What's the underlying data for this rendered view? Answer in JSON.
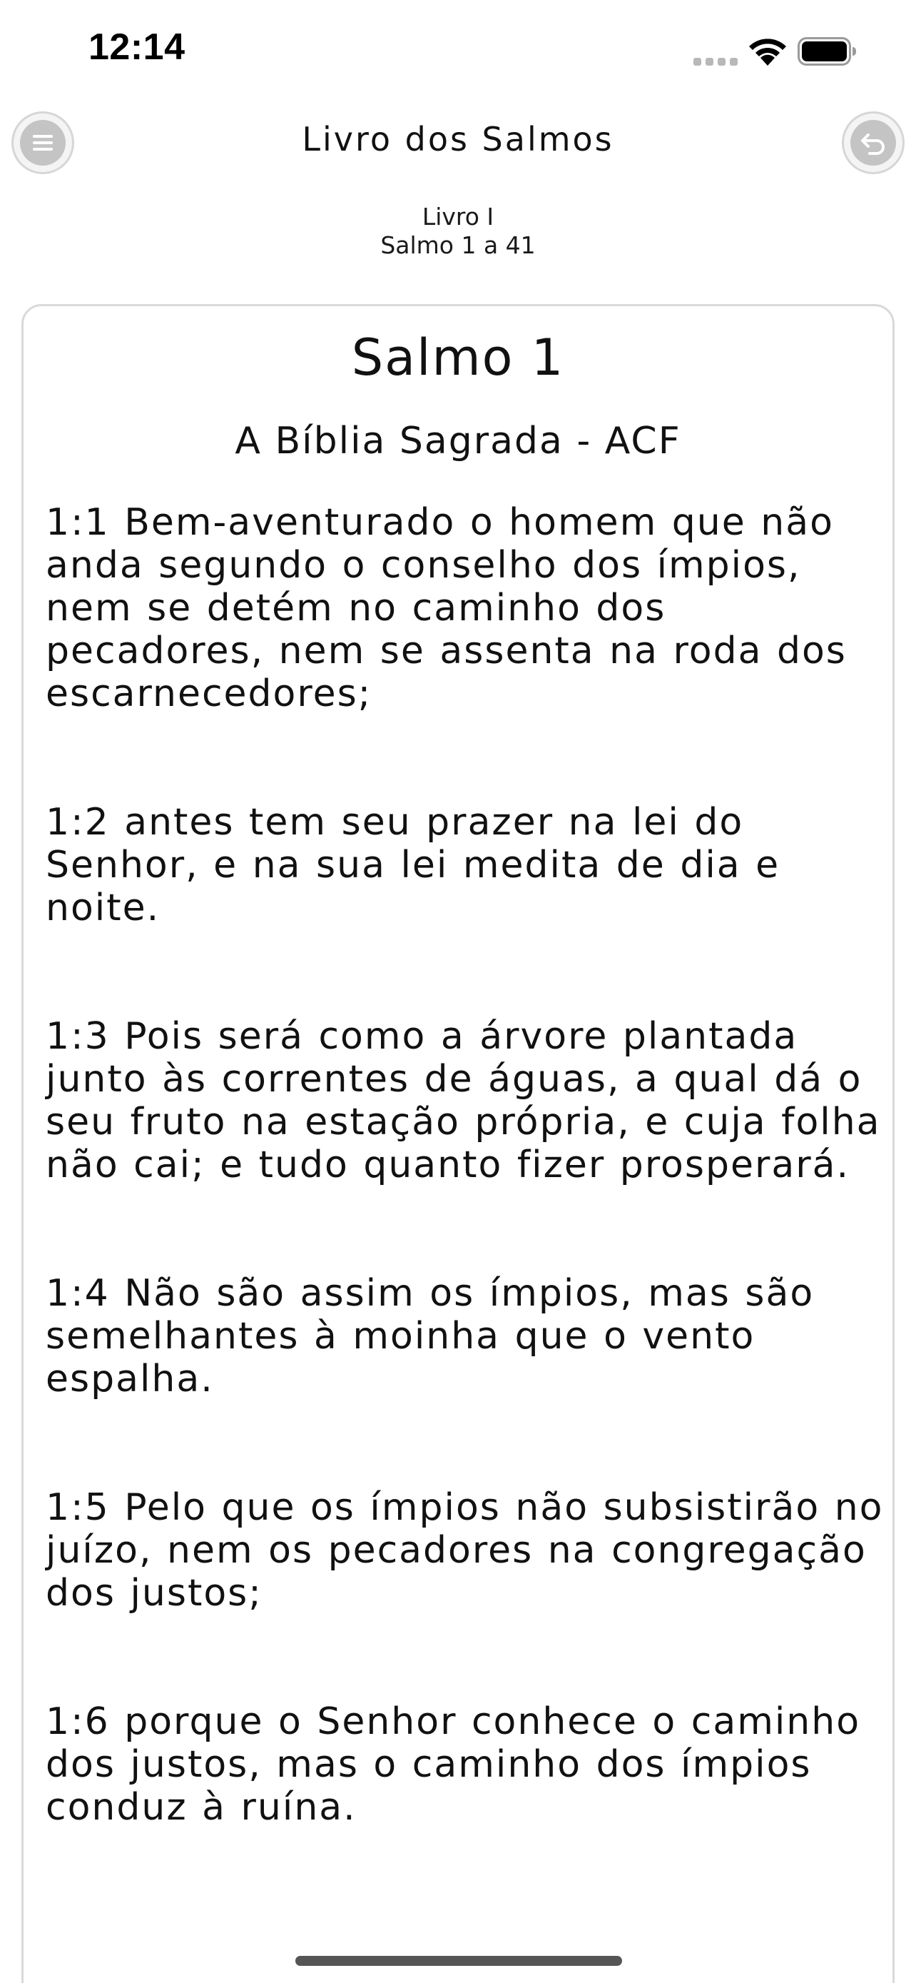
{
  "status_bar": {
    "time": "12:14"
  },
  "header": {
    "title": "Livro dos Salmos",
    "menu_icon": "menu-icon",
    "back_icon": "undo-icon"
  },
  "subtitle": {
    "line1": "Livro I",
    "line2": "Salmo 1 a 41"
  },
  "card": {
    "psalm_title": "Salmo 1",
    "translation": "A Bíblia Sagrada - ACF",
    "verses": [
      "1:1 Bem-aventurado o homem que não anda segundo o conselho dos ímpios, nem se detém no caminho dos pecadores, nem se assenta na roda dos escarnecedores;",
      "1:2 antes tem seu prazer na lei do Senhor, e na sua lei medita de dia e noite.",
      "1:3 Pois será como a árvore plantada junto às correntes de águas, a qual dá o seu fruto na estação própria, e cuja folha não cai; e tudo quanto fizer prosperará.",
      "1:4 Não são assim os ímpios, mas são semelhantes à moinha que o vento espalha.",
      "1:5 Pelo que os ímpios não subsistirão no juízo, nem os pecadores na congregação dos justos;",
      "1:6 porque o Senhor conhece o caminho dos justos, mas o caminho dos ímpios conduz à ruína."
    ]
  },
  "colors": {
    "text": "#111111",
    "button_fill": "#c4c4c4",
    "card_border": "#d9d9d9"
  }
}
